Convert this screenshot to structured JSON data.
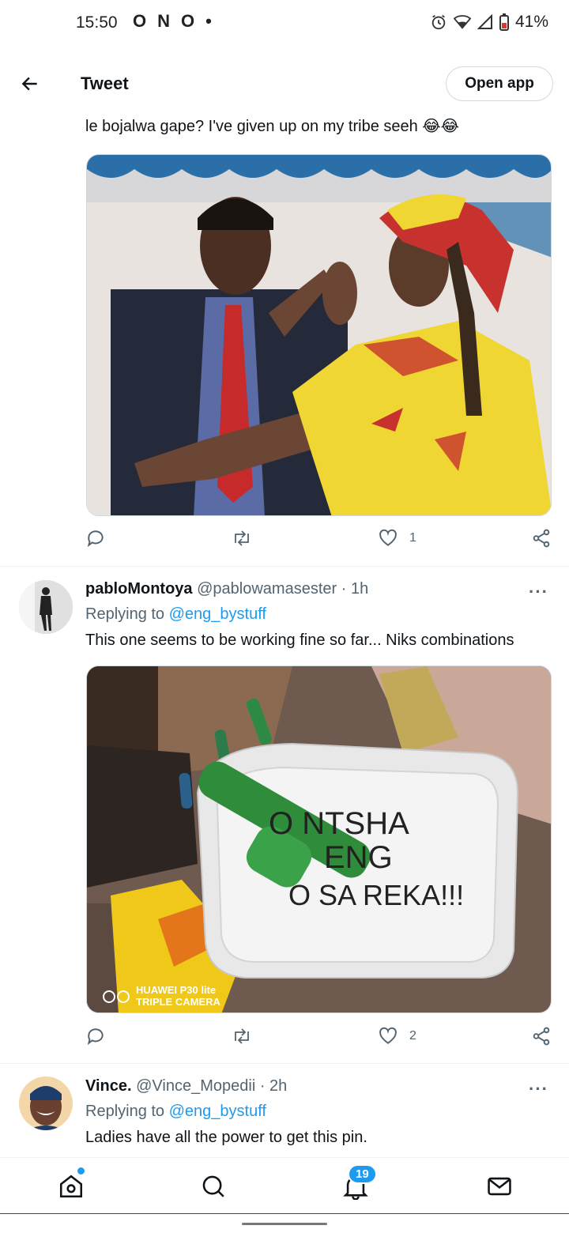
{
  "status_bar": {
    "time": "15:50",
    "left_icons": [
      "O",
      "N",
      "O",
      "•"
    ],
    "battery": "41%"
  },
  "header": {
    "title": "Tweet",
    "open_app_label": "Open app"
  },
  "first_tweet": {
    "text": "le bojalwa gape? I've given up on my tribe seeh 😂😂",
    "like_count": "1"
  },
  "tweets": [
    {
      "name": "pabloMontoya",
      "handle": "@pablowamasester",
      "time": "· 1h",
      "replying_prefix": "Replying to ",
      "replying_to": "@eng_bystuff",
      "text": "This one seems to be working fine so far... Niks combinations",
      "like_count": "2",
      "image": {
        "cooler_text_line1": "O NTSHA",
        "cooler_text_line2": "ENG",
        "cooler_text_line3": "O SA REKA!!!",
        "watermark_line1": "HUAWEI P30 lite",
        "watermark_line2": "TRIPLE CAMERA"
      }
    },
    {
      "name": "Vince.",
      "handle": "@Vince_Mopedii",
      "time": "· 2h",
      "replying_prefix": "Replying to ",
      "replying_to": "@eng_bystuff",
      "text": "Ladies have all the power to get this pin."
    }
  ],
  "more_label": "···",
  "bottom_nav": {
    "notifications_badge": "19"
  },
  "colors": {
    "accent": "#1d9bf0",
    "text_secondary": "#536471"
  }
}
